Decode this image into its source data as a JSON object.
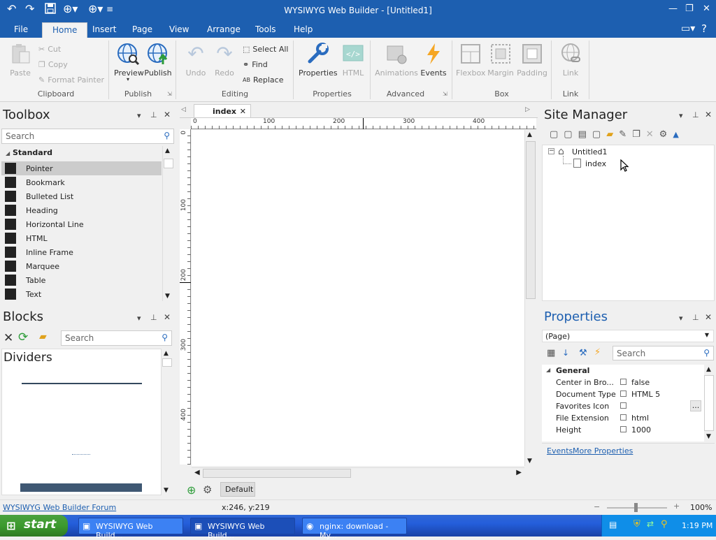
{
  "window": {
    "title": "WYSIWYG Web Builder - [Untitled1]",
    "controls": [
      "minimize-icon",
      "restore-icon",
      "close-icon"
    ]
  },
  "menubar": {
    "file": "File",
    "tabs": [
      "Home",
      "Insert",
      "Page",
      "View",
      "Arrange",
      "Tools",
      "Help"
    ],
    "active_tab": "Home"
  },
  "ribbon": {
    "clipboard": {
      "paste": "Paste",
      "cut": "Cut",
      "copy": "Copy",
      "format_painter": "Format Painter",
      "group": "Clipboard"
    },
    "publish": {
      "preview": "Preview",
      "publish": "Publish",
      "group": "Publish"
    },
    "editing": {
      "undo": "Undo",
      "redo": "Redo",
      "select_all": "Select All",
      "find": "Find",
      "replace": "Replace",
      "group": "Editing"
    },
    "properties": {
      "properties": "Properties",
      "html": "HTML",
      "group": "Properties"
    },
    "advanced": {
      "animations": "Animations",
      "events": "Events",
      "group": "Advanced"
    },
    "box": {
      "flexbox": "Flexbox",
      "margin": "Margin",
      "padding": "Padding",
      "group": "Box"
    },
    "link": {
      "link": "Link",
      "group": "Link"
    }
  },
  "toolbox": {
    "title": "Toolbox",
    "search_placeholder": "Search",
    "category": "Standard",
    "items": [
      {
        "label": "Pointer",
        "icon": "pointer-icon",
        "selected": true
      },
      {
        "label": "Bookmark",
        "icon": "anchor-icon"
      },
      {
        "label": "Bulleted List",
        "icon": "list-icon"
      },
      {
        "label": "Heading",
        "icon": "heading-icon"
      },
      {
        "label": "Horizontal Line",
        "icon": "line-icon"
      },
      {
        "label": "HTML",
        "icon": "code-icon"
      },
      {
        "label": "Inline Frame",
        "icon": "iframe-icon"
      },
      {
        "label": "Marquee",
        "icon": "marquee-icon"
      },
      {
        "label": "Table",
        "icon": "table-icon"
      },
      {
        "label": "Text",
        "icon": "text-icon"
      }
    ]
  },
  "blocks": {
    "title": "Blocks",
    "search_placeholder": "Search",
    "category": "Dividers"
  },
  "editor": {
    "tab": "index",
    "ruler_top": [
      "0",
      "100",
      "200",
      "300",
      "400"
    ],
    "ruler_left": [
      "0",
      "100",
      "200",
      "300",
      "400"
    ],
    "layer": "Default"
  },
  "site_manager": {
    "title": "Site Manager",
    "root": "Untitled1",
    "page": "index"
  },
  "properties": {
    "title": "Properties",
    "selector": "(Page)",
    "search_placeholder": "Search",
    "section": "General",
    "rows": [
      {
        "name": "Center in Bro...",
        "value": "false"
      },
      {
        "name": "Document Type",
        "value": "HTML 5"
      },
      {
        "name": "Favorites Icon",
        "value": ""
      },
      {
        "name": "File Extension",
        "value": "html"
      },
      {
        "name": "Height",
        "value": "1000"
      }
    ],
    "links": {
      "events": "Events",
      "more": "More Properties"
    }
  },
  "statusbar": {
    "forum": "WYSIWYG Web Builder Forum",
    "coords": "x:246, y:219",
    "zoom": "100%"
  },
  "taskbar": {
    "start": "start",
    "tasks": [
      "WYSIWYG Web Build...",
      "WYSIWYG Web Build...",
      "nginx: download - My..."
    ],
    "clock": "1:19 PM"
  },
  "colors": {
    "accent": "#1d5fb0",
    "taskbar": "#245edb",
    "start": "#3c9a2e"
  }
}
